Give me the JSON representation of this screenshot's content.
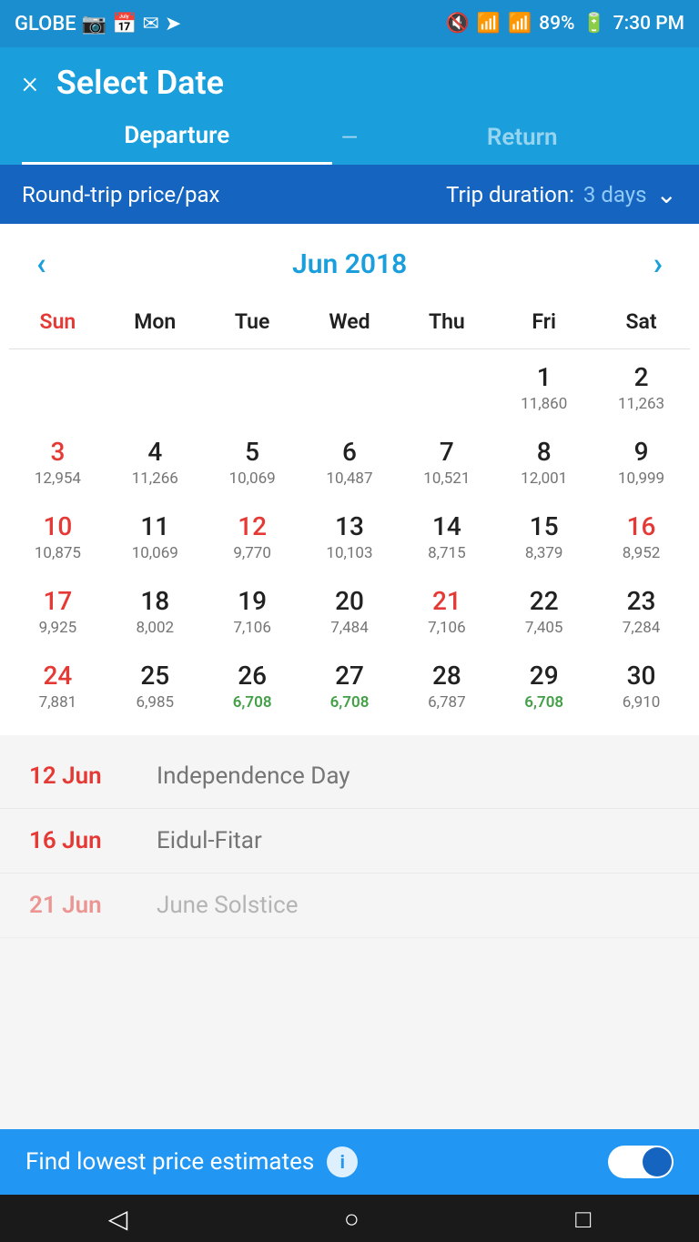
{
  "statusBar": {
    "carrier": "GLOBE",
    "time": "7:30 PM",
    "battery": "89%"
  },
  "header": {
    "title": "Select Date",
    "closeLabel": "×",
    "tabs": {
      "departure": "Departure",
      "divider": "—",
      "return": "Return"
    }
  },
  "tripBar": {
    "leftLabel": "Round-trip price/pax",
    "rightLabel": "Trip duration:",
    "days": "3 days"
  },
  "calendar": {
    "monthTitle": "Jun 2018",
    "dayNames": [
      "Sun",
      "Mon",
      "Tue",
      "Wed",
      "Thu",
      "Fri",
      "Sat"
    ],
    "weeks": [
      [
        {
          "date": "",
          "price": ""
        },
        {
          "date": "",
          "price": ""
        },
        {
          "date": "",
          "price": ""
        },
        {
          "date": "",
          "price": ""
        },
        {
          "date": "",
          "price": ""
        },
        {
          "date": "1",
          "price": "11,860",
          "dateColor": "black",
          "priceColor": "normal"
        },
        {
          "date": "2",
          "price": "11,263",
          "dateColor": "black",
          "priceColor": "normal"
        }
      ],
      [
        {
          "date": "3",
          "price": "12,954",
          "dateColor": "red",
          "priceColor": "normal"
        },
        {
          "date": "4",
          "price": "11,266",
          "dateColor": "black",
          "priceColor": "normal"
        },
        {
          "date": "5",
          "price": "10,069",
          "dateColor": "black",
          "priceColor": "normal"
        },
        {
          "date": "6",
          "price": "10,487",
          "dateColor": "black",
          "priceColor": "normal"
        },
        {
          "date": "7",
          "price": "10,521",
          "dateColor": "black",
          "priceColor": "normal"
        },
        {
          "date": "8",
          "price": "12,001",
          "dateColor": "black",
          "priceColor": "normal"
        },
        {
          "date": "9",
          "price": "10,999",
          "dateColor": "black",
          "priceColor": "normal"
        }
      ],
      [
        {
          "date": "10",
          "price": "10,875",
          "dateColor": "red",
          "priceColor": "normal"
        },
        {
          "date": "11",
          "price": "10,069",
          "dateColor": "black",
          "priceColor": "normal"
        },
        {
          "date": "12",
          "price": "9,770",
          "dateColor": "red",
          "priceColor": "normal"
        },
        {
          "date": "13",
          "price": "10,103",
          "dateColor": "black",
          "priceColor": "normal"
        },
        {
          "date": "14",
          "price": "8,715",
          "dateColor": "black",
          "priceColor": "normal"
        },
        {
          "date": "15",
          "price": "8,379",
          "dateColor": "black",
          "priceColor": "normal"
        },
        {
          "date": "16",
          "price": "8,952",
          "dateColor": "red",
          "priceColor": "normal"
        }
      ],
      [
        {
          "date": "17",
          "price": "9,925",
          "dateColor": "red",
          "priceColor": "normal"
        },
        {
          "date": "18",
          "price": "8,002",
          "dateColor": "black",
          "priceColor": "normal"
        },
        {
          "date": "19",
          "price": "7,106",
          "dateColor": "black",
          "priceColor": "normal"
        },
        {
          "date": "20",
          "price": "7,484",
          "dateColor": "black",
          "priceColor": "normal"
        },
        {
          "date": "21",
          "price": "7,106",
          "dateColor": "red",
          "priceColor": "normal"
        },
        {
          "date": "22",
          "price": "7,405",
          "dateColor": "black",
          "priceColor": "normal"
        },
        {
          "date": "23",
          "price": "7,284",
          "dateColor": "black",
          "priceColor": "normal"
        }
      ],
      [
        {
          "date": "24",
          "price": "7,881",
          "dateColor": "red",
          "priceColor": "normal"
        },
        {
          "date": "25",
          "price": "6,985",
          "dateColor": "black",
          "priceColor": "normal"
        },
        {
          "date": "26",
          "price": "6,708",
          "dateColor": "black",
          "priceColor": "green"
        },
        {
          "date": "27",
          "price": "6,708",
          "dateColor": "black",
          "priceColor": "green"
        },
        {
          "date": "28",
          "price": "6,787",
          "dateColor": "black",
          "priceColor": "normal"
        },
        {
          "date": "29",
          "price": "6,708",
          "dateColor": "black",
          "priceColor": "green"
        },
        {
          "date": "30",
          "price": "6,910",
          "dateColor": "black",
          "priceColor": "normal"
        }
      ]
    ]
  },
  "holidays": [
    {
      "date": "12 Jun",
      "name": "Independence Day"
    },
    {
      "date": "16 Jun",
      "name": "Eidul-Fitar"
    },
    {
      "date": "21 Jun",
      "name": "June Solstice",
      "partial": true
    }
  ],
  "bottomBar": {
    "label": "Find lowest price estimates",
    "toggleOn": true
  },
  "androidNav": {
    "back": "◁",
    "home": "○",
    "recent": "□"
  }
}
